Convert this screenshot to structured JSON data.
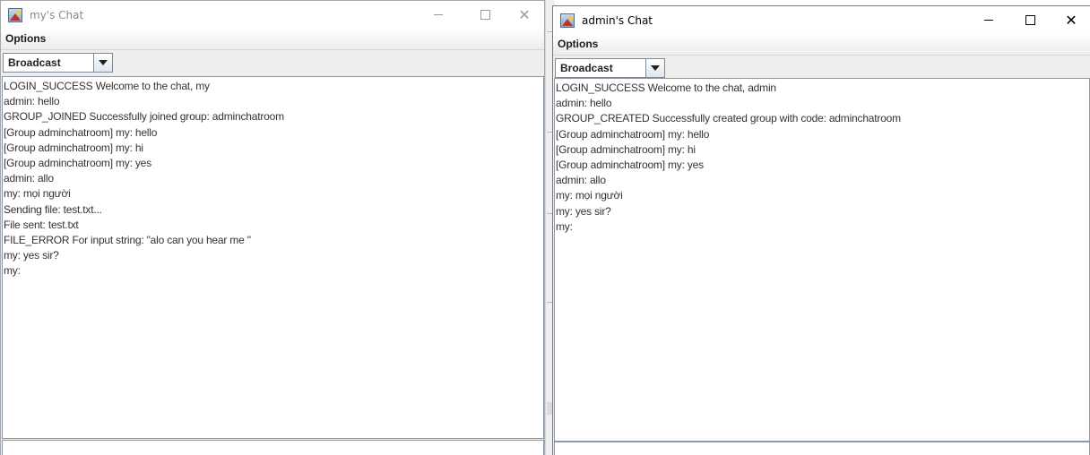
{
  "windows": [
    {
      "title": "my's Chat",
      "menu": {
        "options_label": "Options"
      },
      "target_select": {
        "value": "Broadcast"
      },
      "messages": [
        "LOGIN_SUCCESS Welcome to the chat, my",
        "admin: hello",
        "GROUP_JOINED Successfully joined group: adminchatroom",
        "[Group adminchatroom] my: hello",
        "[Group adminchatroom] my: hi",
        "[Group adminchatroom] my: yes",
        "admin: allo",
        "my: mọi người",
        "Sending file: test.txt...",
        "File sent: test.txt",
        "FILE_ERROR For input string: \"alo can you hear me \"",
        "my: yes sir?",
        "my:"
      ],
      "input_value": ""
    },
    {
      "title": "admin's Chat",
      "menu": {
        "options_label": "Options"
      },
      "target_select": {
        "value": "Broadcast"
      },
      "messages": [
        "LOGIN_SUCCESS Welcome to the chat, admin",
        "admin: hello",
        "GROUP_CREATED Successfully created group with code: adminchatroom",
        "[Group adminchatroom] my: hello",
        "[Group adminchatroom] my: hi",
        "[Group adminchatroom] my: yes",
        "admin: allo",
        "my: mọi người",
        "my: yes sir?",
        "my:"
      ],
      "input_value": ""
    }
  ],
  "window_controls": {
    "minimize": "—",
    "maximize": "□",
    "close": "✕"
  },
  "icons": {
    "app": "java-app-icon",
    "dropdown": "chevron-down-icon"
  },
  "colors": {
    "titlebar": "#ffffff",
    "chrome": "#eeeeee",
    "text": "#333333",
    "inactive_title": "#8a8a8a"
  }
}
